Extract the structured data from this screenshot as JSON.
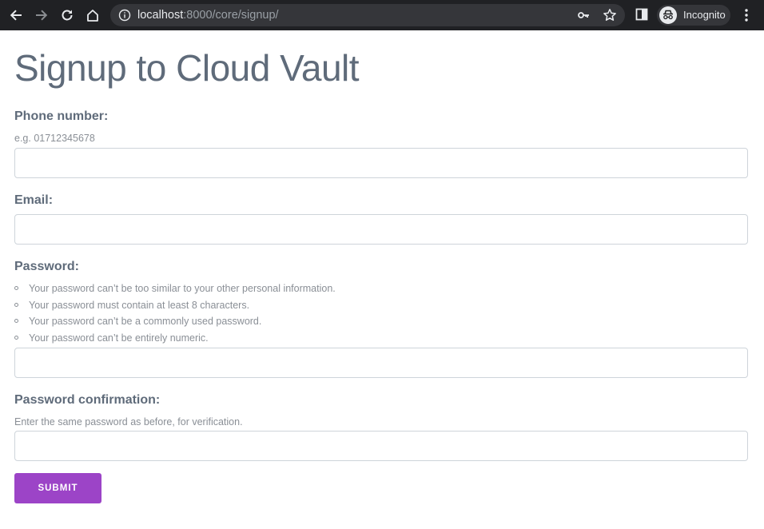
{
  "browser": {
    "url_host": "localhost",
    "url_path": ":8000/core/signup/",
    "profile_label": "Incognito",
    "icons": [
      "back-icon",
      "forward-icon",
      "reload-icon",
      "home-icon",
      "info-icon",
      "key-icon",
      "star-icon",
      "side-panel-icon",
      "incognito-icon",
      "menu-icon"
    ]
  },
  "page": {
    "title": "Signup to Cloud Vault",
    "phone": {
      "label": "Phone number:",
      "hint": "e.g. 01712345678",
      "value": ""
    },
    "email": {
      "label": "Email:",
      "value": ""
    },
    "password": {
      "label": "Password:",
      "rules": [
        "Your password can’t be too similar to your other personal information.",
        "Your password must contain at least 8 characters.",
        "Your password can’t be a commonly used password.",
        "Your password can’t be entirely numeric."
      ],
      "value": ""
    },
    "password_confirmation": {
      "label": "Password confirmation:",
      "hint": "Enter the same password as before, for verification.",
      "value": ""
    },
    "submit_label": "SUBMIT",
    "accent_color": "#9c44c7"
  }
}
